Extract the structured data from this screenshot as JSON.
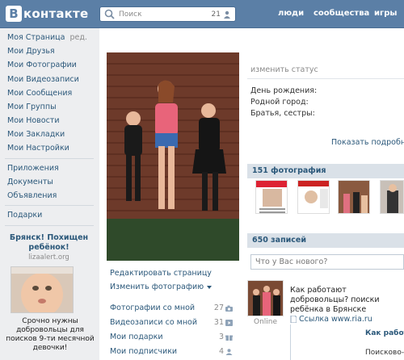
{
  "header": {
    "logo_letter": "В",
    "logo_text": "контакте",
    "search_placeholder": "Поиск",
    "search_count": "21",
    "nav": [
      "люди",
      "сообщества",
      "игры"
    ]
  },
  "sidebar": {
    "items": [
      "Моя Страница",
      "Мои Друзья",
      "Мои Фотографии",
      "Мои Видеозаписи",
      "Мои Сообщения",
      "Мои Группы",
      "Мои Новости",
      "Мои Закладки",
      "Мои Настройки"
    ],
    "edit_label": "ред.",
    "extra": [
      "Приложения",
      "Документы",
      "Объявления"
    ],
    "gifts": "Подарки",
    "ad": {
      "title": "Брянск! Похищен ребёнок!",
      "site": "lizaalert.org",
      "text": "Срочно нужны добровольцы для поисков 9-ти месячной девочки!"
    }
  },
  "profile": {
    "actions": [
      "Редактировать страницу",
      "Изменить фотографию"
    ],
    "stats": [
      {
        "label": "Фотографии со мной",
        "count": "27"
      },
      {
        "label": "Видеозаписи со мной",
        "count": "31"
      },
      {
        "label": "Мои подарки",
        "count": "3"
      },
      {
        "label": "Мои подписчики",
        "count": "4"
      }
    ],
    "status_placeholder": "изменить статус",
    "info": [
      "День рождения:",
      "Родной город:",
      "Братья, сестры:"
    ],
    "more": "Показать подробную",
    "photos_header": "151 фотография",
    "wall_header": "650 записей",
    "wall_placeholder": "Что у Вас нового?",
    "post": {
      "text": "Как работают добровольцы? поиски ребёнка в Брянске",
      "link": "Ссылка www.ria.ru",
      "online": "Online",
      "repost_title": "Как работают",
      "repost_sub": "Поисково-сп"
    }
  }
}
